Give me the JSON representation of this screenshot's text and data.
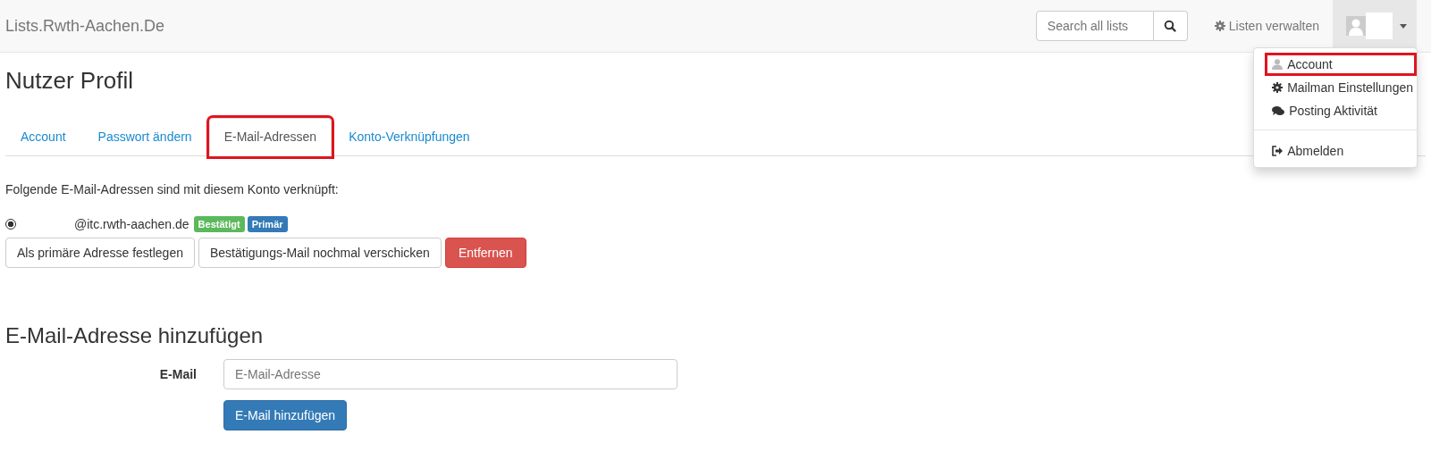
{
  "navbar": {
    "brand": "Lists.Rwth-Aachen.De",
    "search": {
      "placeholder": "Search all lists"
    },
    "manage_link": "Listen verwalten",
    "user_menu": {
      "expanded": true,
      "items": [
        {
          "kind": "item",
          "label": "Account",
          "highlighted": true
        },
        {
          "kind": "item",
          "label": "Mailman Einstellungen",
          "highlighted": false
        },
        {
          "kind": "item",
          "label": "Posting Aktivität",
          "highlighted": false
        },
        {
          "kind": "divider"
        },
        {
          "kind": "item",
          "label": "Abmelden",
          "highlighted": false
        }
      ]
    }
  },
  "page_title": "Nutzer Profil",
  "tabs": [
    {
      "label": "Account",
      "selected": false,
      "highlighted": false
    },
    {
      "label": "Passwort ändern",
      "selected": false,
      "highlighted": false
    },
    {
      "label": "E-Mail-Adressen",
      "selected": true,
      "highlighted": true
    },
    {
      "label": "Konto-Verknüpfungen",
      "selected": false,
      "highlighted": false
    }
  ],
  "intro": "Folgende E-Mail-Adressen sind mit diesem Konto verknüpft:",
  "addresses": [
    {
      "address": "@itc.rwth-aachen.de",
      "selected": true,
      "badges": [
        {
          "label": "Bestätigt",
          "color": "#5cb85c"
        },
        {
          "label": "Primär",
          "color": "#337ab7"
        }
      ]
    }
  ],
  "address_actions": [
    {
      "label": "Als primäre Adresse festlegen",
      "kind": "default"
    },
    {
      "label": "Bestätigungs-Mail nochmal verschicken",
      "kind": "default"
    },
    {
      "label": "Entfernen",
      "kind": "danger"
    }
  ],
  "add_section": {
    "heading": "E-Mail-Adresse hinzufügen",
    "field_label": "E-Mail",
    "placeholder": "E-Mail-Adresse",
    "submit": "E-Mail hinzufügen"
  }
}
